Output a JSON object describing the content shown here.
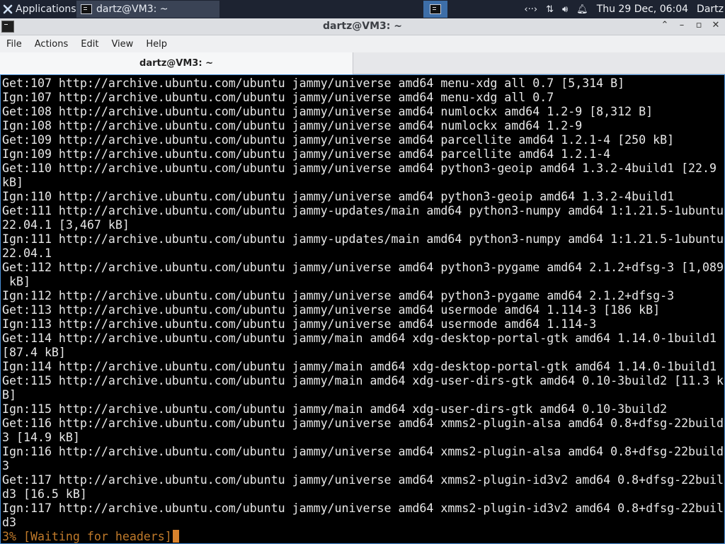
{
  "panel": {
    "applications_label": "Applications",
    "task_title": "dartz@VM3: ~",
    "clock": "Thu 29 Dec, 06:04",
    "user": "Dartz",
    "tray_icons": [
      "network-icon",
      "transfer-icon",
      "volume-icon",
      "notification-bell-icon"
    ]
  },
  "window": {
    "title": "dartz@VM3: ~",
    "menu": [
      "File",
      "Actions",
      "Edit",
      "View",
      "Help"
    ],
    "tab_label": "dartz@VM3: ~"
  },
  "terminal": {
    "lines": [
      "Get:107 http://archive.ubuntu.com/ubuntu jammy/universe amd64 menu-xdg all 0.7 [5,314 B]",
      "Ign:107 http://archive.ubuntu.com/ubuntu jammy/universe amd64 menu-xdg all 0.7",
      "Get:108 http://archive.ubuntu.com/ubuntu jammy/universe amd64 numlockx amd64 1.2-9 [8,312 B]",
      "Ign:108 http://archive.ubuntu.com/ubuntu jammy/universe amd64 numlockx amd64 1.2-9",
      "Get:109 http://archive.ubuntu.com/ubuntu jammy/universe amd64 parcellite amd64 1.2.1-4 [250 kB]",
      "Ign:109 http://archive.ubuntu.com/ubuntu jammy/universe amd64 parcellite amd64 1.2.1-4",
      "Get:110 http://archive.ubuntu.com/ubuntu jammy/universe amd64 python3-geoip amd64 1.3.2-4build1 [22.9",
      "kB]",
      "Ign:110 http://archive.ubuntu.com/ubuntu jammy/universe amd64 python3-geoip amd64 1.3.2-4build1",
      "Get:111 http://archive.ubuntu.com/ubuntu jammy-updates/main amd64 python3-numpy amd64 1:1.21.5-1ubuntu",
      "22.04.1 [3,467 kB]",
      "Ign:111 http://archive.ubuntu.com/ubuntu jammy-updates/main amd64 python3-numpy amd64 1:1.21.5-1ubuntu",
      "22.04.1",
      "Get:112 http://archive.ubuntu.com/ubuntu jammy/universe amd64 python3-pygame amd64 2.1.2+dfsg-3 [1,089",
      " kB]",
      "Ign:112 http://archive.ubuntu.com/ubuntu jammy/universe amd64 python3-pygame amd64 2.1.2+dfsg-3",
      "Get:113 http://archive.ubuntu.com/ubuntu jammy/universe amd64 usermode amd64 1.114-3 [186 kB]",
      "Ign:113 http://archive.ubuntu.com/ubuntu jammy/universe amd64 usermode amd64 1.114-3",
      "Get:114 http://archive.ubuntu.com/ubuntu jammy/main amd64 xdg-desktop-portal-gtk amd64 1.14.0-1build1",
      "[87.4 kB]",
      "Ign:114 http://archive.ubuntu.com/ubuntu jammy/main amd64 xdg-desktop-portal-gtk amd64 1.14.0-1build1",
      "Get:115 http://archive.ubuntu.com/ubuntu jammy/main amd64 xdg-user-dirs-gtk amd64 0.10-3build2 [11.3 k",
      "B]",
      "Ign:115 http://archive.ubuntu.com/ubuntu jammy/main amd64 xdg-user-dirs-gtk amd64 0.10-3build2",
      "Get:116 http://archive.ubuntu.com/ubuntu jammy/universe amd64 xmms2-plugin-alsa amd64 0.8+dfsg-22build",
      "3 [14.9 kB]",
      "Ign:116 http://archive.ubuntu.com/ubuntu jammy/universe amd64 xmms2-plugin-alsa amd64 0.8+dfsg-22build",
      "3",
      "Get:117 http://archive.ubuntu.com/ubuntu jammy/universe amd64 xmms2-plugin-id3v2 amd64 0.8+dfsg-22buil",
      "d3 [16.5 kB]",
      "Ign:117 http://archive.ubuntu.com/ubuntu jammy/universe amd64 xmms2-plugin-id3v2 amd64 0.8+dfsg-22buil",
      "d3"
    ],
    "status_line": "3% [Waiting for headers]"
  }
}
